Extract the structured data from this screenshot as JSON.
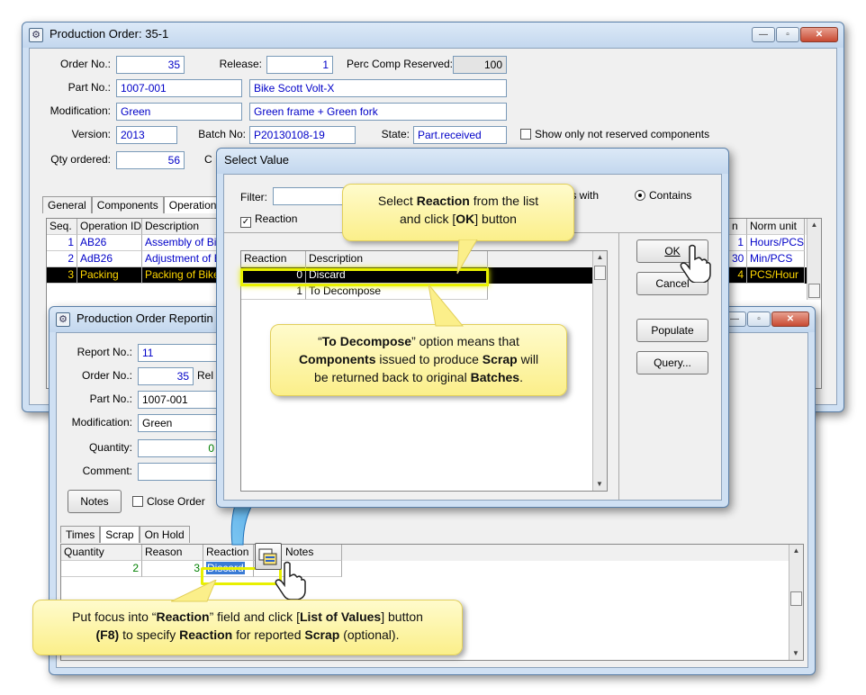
{
  "po_window": {
    "title": "Production Order: 35-1",
    "order_no_label": "Order No.:",
    "order_no": "35",
    "release_label": "Release:",
    "release": "1",
    "perc_label": "Perc Comp Reserved:",
    "perc": "100",
    "part_no_label": "Part No.:",
    "part_no": "1007-001",
    "part_desc": "Bike Scott Volt-X",
    "modification_label": "Modification:",
    "modification": "Green",
    "modification_desc": "Green frame + Green fork",
    "version_label": "Version:",
    "version": "2013",
    "batch_label": "Batch No:",
    "batch": "P20130108-19",
    "state_label": "State:",
    "state": "Part.received",
    "show_label": "Show only not reserved components",
    "qty_label": "Qty ordered:",
    "qty": "56",
    "qty_cut": "C",
    "tabs": [
      "General",
      "Components",
      "Operations"
    ],
    "ops_headers": [
      "Seq.",
      "Operation ID",
      "Description"
    ],
    "ops_rows": [
      [
        "1",
        "AB26",
        "Assembly of Bik"
      ],
      [
        "2",
        "AdB26",
        "Adjustment of B"
      ],
      [
        "3",
        "Packing",
        "Packing of Bike"
      ]
    ],
    "norm_headers": [
      "n",
      "Norm unit"
    ],
    "norm_rows": [
      [
        "1",
        "Hours/PCS"
      ],
      [
        "30",
        "Min/PCS"
      ],
      [
        "4",
        "PCS/Hour"
      ]
    ]
  },
  "report_window": {
    "title": "Production Order Reportin",
    "report_no_label": "Report No.:",
    "report_no": "11",
    "order_no_label": "Order No.:",
    "order_no": "35",
    "rel_cut": "Rel",
    "part_no_label": "Part No.:",
    "part_no": "1007-001",
    "modification_label": "Modification:",
    "modification": "Green",
    "quantity_label": "Quantity:",
    "quantity": "0",
    "comment_label": "Comment:",
    "notes_btn": "Notes",
    "close_order_label": "Close Order",
    "tabs": [
      "Times",
      "Scrap",
      "On Hold"
    ],
    "scrap_headers": [
      "Quantity",
      "Reason",
      "Reaction",
      "Notes"
    ],
    "scrap_row": [
      "2",
      "3",
      "Discard",
      ""
    ]
  },
  "select_dialog": {
    "title": "Select Value",
    "filter_label": "Filter:",
    "starts_with": "Starts with",
    "contains": "Contains",
    "reaction_check": "Reaction",
    "headers": [
      "Reaction",
      "Description"
    ],
    "rows": [
      [
        "0",
        "Discard"
      ],
      [
        "1",
        "To Decompose"
      ]
    ],
    "ok": "OK",
    "cancel": "Cancel",
    "populate": "Populate",
    "query": "Query..."
  },
  "callouts": {
    "select_reaction": [
      "Select ",
      "Reaction",
      " from the list",
      "and click [",
      "OK",
      "] button"
    ],
    "decompose": [
      "“",
      "To Decompose",
      "” option means that",
      "Components",
      " issued to produce ",
      "Scrap",
      " will",
      "be returned back to original ",
      "Batches",
      "."
    ],
    "focus": [
      "Put focus into “",
      "Reaction",
      "” field and click [",
      "List of Values",
      "] button",
      "(F8)",
      " to specify ",
      "Reaction",
      " for reported ",
      "Scrap",
      " (optional)."
    ]
  },
  "colors": {
    "accent_blue": "#0000c8",
    "highlight_yellow": "#e8f000",
    "callout_yellow": "#fbef8a",
    "arrow_blue": "#2d9be0"
  }
}
